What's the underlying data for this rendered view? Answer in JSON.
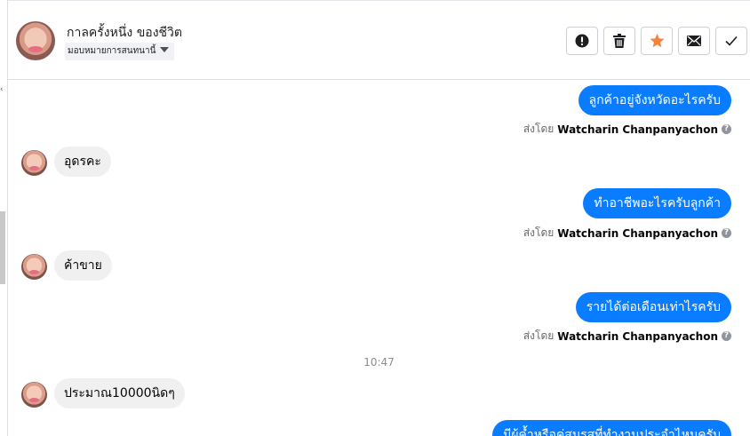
{
  "header": {
    "contact_name": "กาลครั้งหนึ่ง ของชีวิต",
    "assign_label": "มอบหมายการสนทนานี้",
    "actions": [
      "mark-spam",
      "delete",
      "star",
      "mark-unread",
      "mark-done"
    ]
  },
  "colors": {
    "outgoing_bubble": "#0a7cff",
    "incoming_bubble": "#f0f0f0",
    "star_accent": "#f5833b"
  },
  "messages": [
    {
      "direction": "out",
      "text": "ลูกค้าอยู่จังหวัดอะไรครับ",
      "sent_by_prefix": "ส่งโดย",
      "sender": "Watcharin Chanpanyachon",
      "help": "?"
    },
    {
      "direction": "in",
      "text": "อุดรคะ"
    },
    {
      "direction": "out",
      "text": "ทำอาชีพอะไรครับลูกค้า",
      "sent_by_prefix": "ส่งโดย",
      "sender": "Watcharin Chanpanyachon",
      "help": "?"
    },
    {
      "direction": "in",
      "text": "ค้าขาย"
    },
    {
      "direction": "out",
      "text": "รายได้ต่อเดือนเท่าไรครับ",
      "sent_by_prefix": "ส่งโดย",
      "sender": "Watcharin Chanpanyachon",
      "help": "?"
    },
    {
      "direction": "time",
      "text": "10:47"
    },
    {
      "direction": "in",
      "text": "ประมาณ10000นิดๆ"
    },
    {
      "direction": "out",
      "text": "มีผู้ค้ำหรือคู่สมรสที่ทำงานประจำไหมครับ"
    }
  ]
}
